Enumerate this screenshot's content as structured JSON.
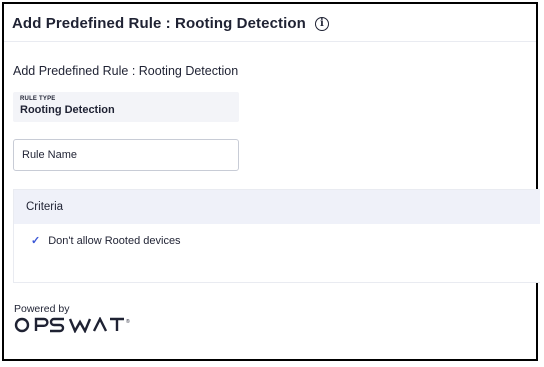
{
  "header": {
    "title": "Add Predefined Rule : Rooting Detection",
    "info_icon": "info-icon"
  },
  "form": {
    "subtitle": "Add Predefined Rule : Rooting Detection",
    "rule_type_label": "RULE TYPE",
    "rule_type_value": "Rooting Detection",
    "rule_name_placeholder": "Rule Name",
    "rule_name_value": ""
  },
  "criteria": {
    "title": "Criteria",
    "items": [
      {
        "icon": "check-icon",
        "label": "Don't allow Rooted devices"
      }
    ]
  },
  "footer": {
    "powered_by": "Powered by",
    "logo_text": "OPSWAT"
  },
  "colors": {
    "accent": "#3b57d6",
    "criteria_header_bg": "#eff1f9",
    "rule_type_bg": "#f3f4f8",
    "text": "#1f2233"
  }
}
